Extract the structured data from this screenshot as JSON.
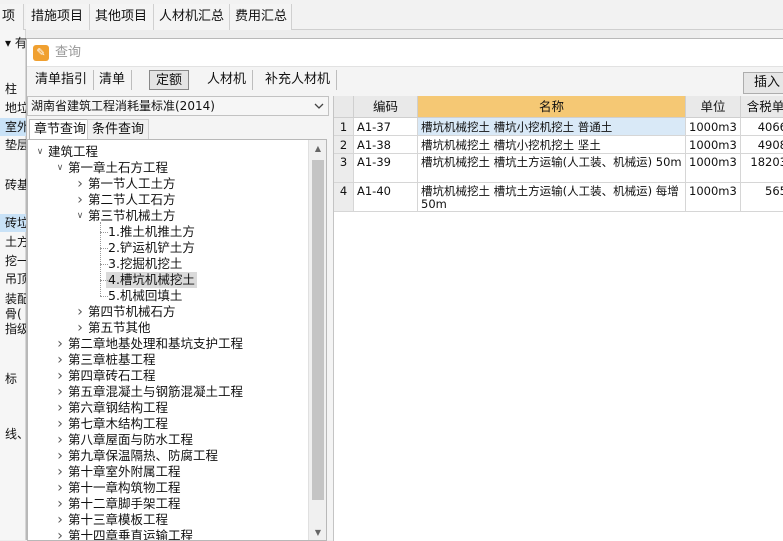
{
  "top_tabs": [
    "项",
    "措施项目",
    "其他项目",
    "人材机汇总",
    "费用汇总"
  ],
  "background_left": {
    "cells": [
      "▾ 有",
      "柱",
      "地垃",
      "室外",
      "垫层",
      "砖基",
      "砖垃",
      "土方",
      "挖一",
      "吊顶",
      "装配",
      "骨(",
      "指级",
      "标",
      "线、"
    ]
  },
  "dialog": {
    "title": "查询",
    "toolbar": [
      "清单指引",
      "清单",
      "定额",
      "人材机",
      "补充人材机"
    ],
    "active_toolbar": "定额",
    "insert_button": "插入",
    "standard_select": "湖南省建筑工程消耗量标准(2014)",
    "left_tabs": [
      "章节查询",
      "条件查询"
    ],
    "tree": [
      {
        "label": "建筑工程",
        "level": 0,
        "state": "open"
      },
      {
        "label": "第一章土石方工程",
        "level": 1,
        "state": "open"
      },
      {
        "label": "第一节人工土方",
        "level": 2,
        "state": "closed"
      },
      {
        "label": "第二节人工石方",
        "level": 2,
        "state": "closed"
      },
      {
        "label": "第三节机械土方",
        "level": 2,
        "state": "open"
      },
      {
        "label": "1.推土机推土方",
        "level": 3,
        "state": "leaf"
      },
      {
        "label": "2.铲运机铲土方",
        "level": 3,
        "state": "leaf"
      },
      {
        "label": "3.挖掘机挖土",
        "level": 3,
        "state": "leaf"
      },
      {
        "label": "4.槽坑机械挖土",
        "level": 3,
        "state": "leaf",
        "selected": true
      },
      {
        "label": "5.机械回填土",
        "level": 3,
        "state": "leaf"
      },
      {
        "label": "第四节机械石方",
        "level": 2,
        "state": "closed"
      },
      {
        "label": "第五节其他",
        "level": 2,
        "state": "closed"
      },
      {
        "label": "第二章地基处理和基坑支护工程",
        "level": 1,
        "state": "closed"
      },
      {
        "label": "第三章桩基工程",
        "level": 1,
        "state": "closed"
      },
      {
        "label": "第四章砖石工程",
        "level": 1,
        "state": "closed"
      },
      {
        "label": "第五章混凝土与钢筋混凝土工程",
        "level": 1,
        "state": "closed"
      },
      {
        "label": "第六章钢结构工程",
        "level": 1,
        "state": "closed"
      },
      {
        "label": "第七章木结构工程",
        "level": 1,
        "state": "closed"
      },
      {
        "label": "第八章屋面与防水工程",
        "level": 1,
        "state": "closed"
      },
      {
        "label": "第九章保温隔热、防腐工程",
        "level": 1,
        "state": "closed"
      },
      {
        "label": "第十章室外附属工程",
        "level": 1,
        "state": "closed"
      },
      {
        "label": "第十一章构筑物工程",
        "level": 1,
        "state": "closed"
      },
      {
        "label": "第十二章脚手架工程",
        "level": 1,
        "state": "closed"
      },
      {
        "label": "第十三章模板工程",
        "level": 1,
        "state": "closed"
      },
      {
        "label": "第十四章垂直运输工程",
        "level": 1,
        "state": "closed"
      }
    ],
    "table": {
      "headers": [
        "",
        "编码",
        "名称",
        "单位",
        "含税单"
      ],
      "rows": [
        {
          "n": "1",
          "code": "A1-37",
          "name": "槽坑机械挖土 槽坑小挖机挖土 普通土",
          "unit": "1000m3",
          "price": "4066"
        },
        {
          "n": "2",
          "code": "A1-38",
          "name": "槽坑机械挖土 槽坑小挖机挖土 坚土",
          "unit": "1000m3",
          "price": "4908"
        },
        {
          "n": "3",
          "code": "A1-39",
          "name": "槽坑机械挖土 槽坑土方运输(人工装、机械运) 50m",
          "unit": "1000m3",
          "price": "18203"
        },
        {
          "n": "4",
          "code": "A1-40",
          "name": "槽坑机械挖土 槽坑土方运输(人工装、机械运) 每增50m",
          "unit": "1000m3",
          "price": "565"
        }
      ]
    }
  }
}
